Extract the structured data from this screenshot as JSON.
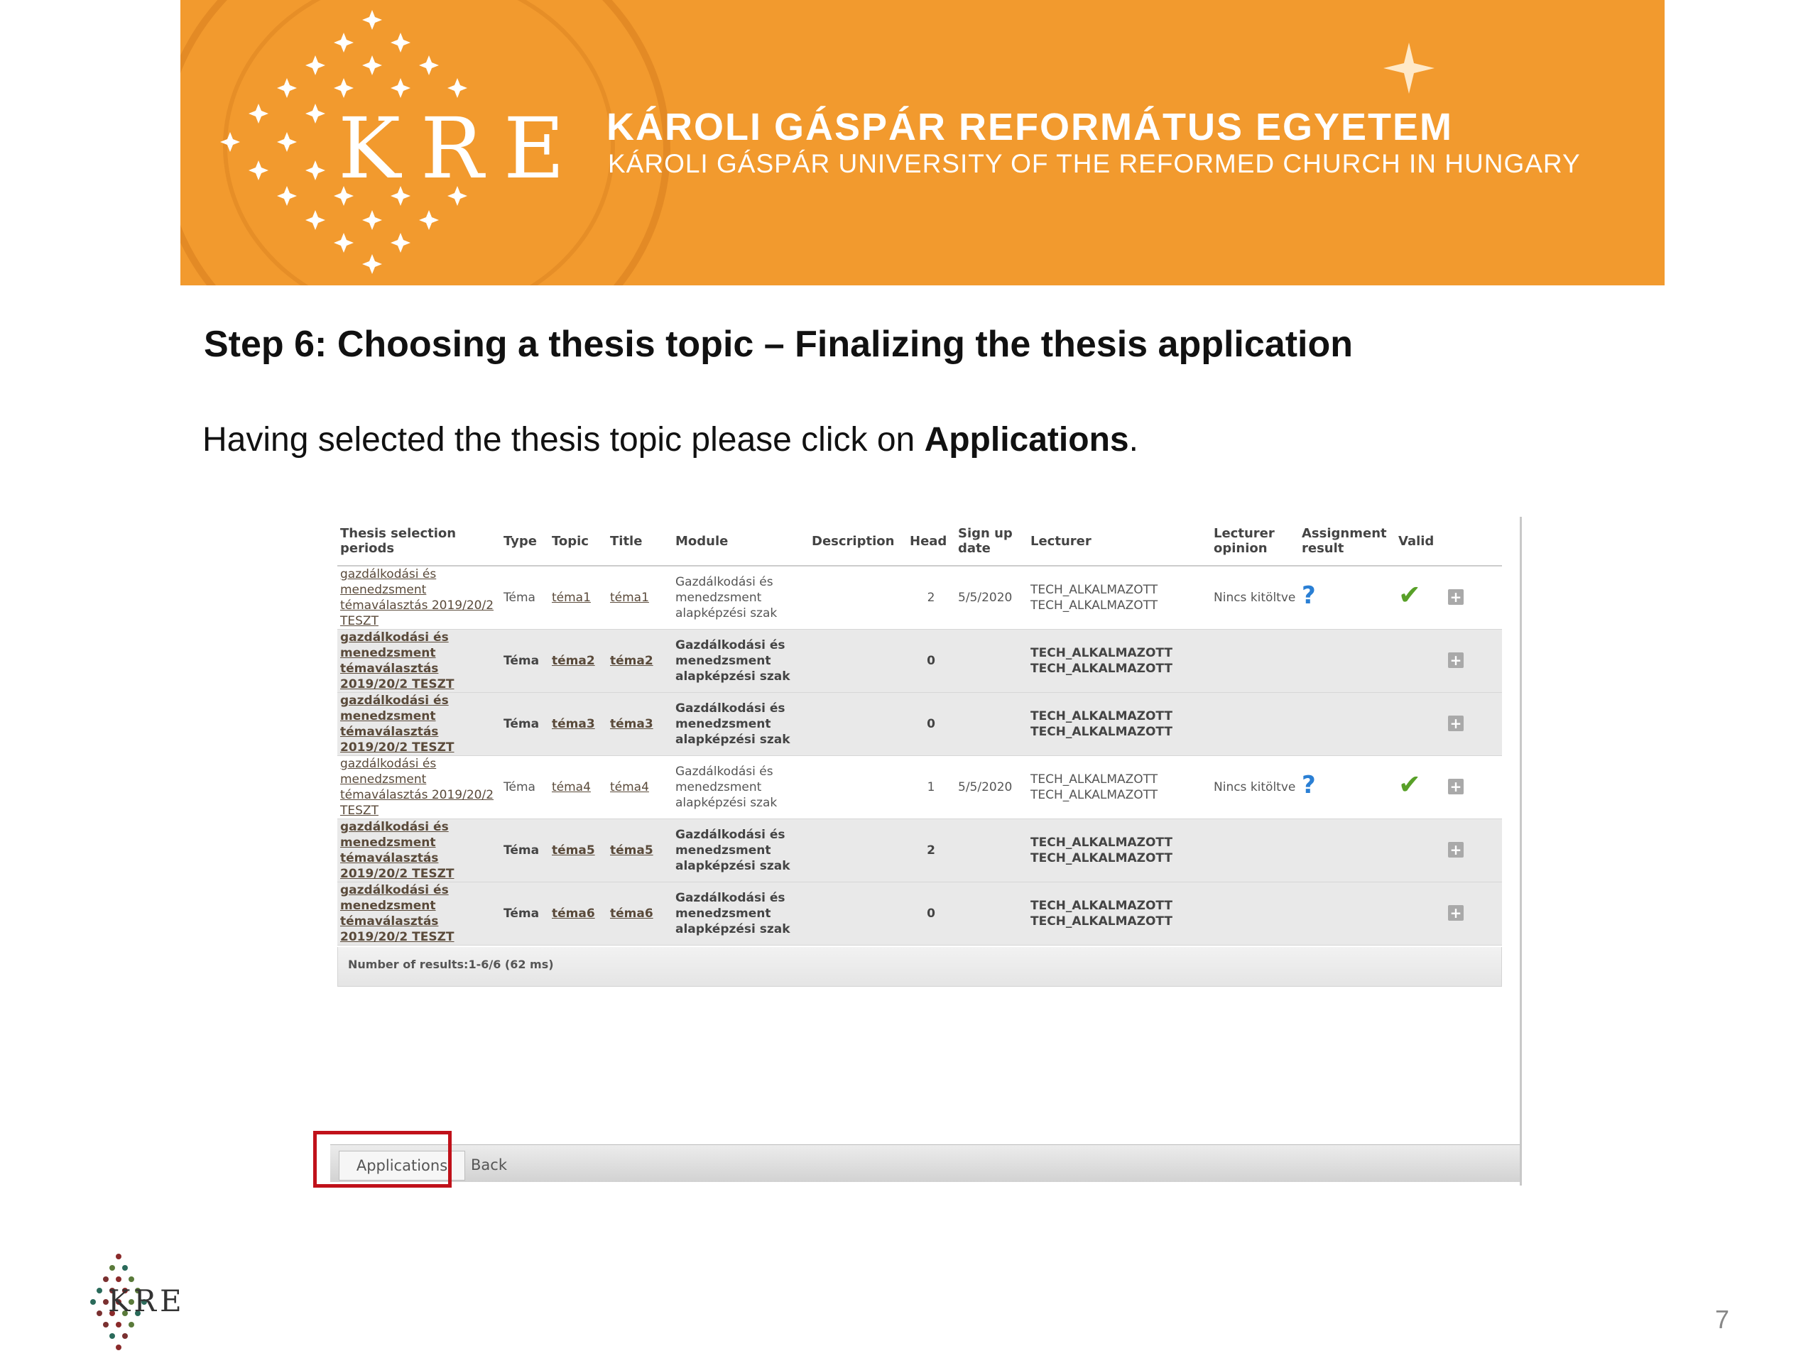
{
  "banner": {
    "logo": "KRE",
    "university_hu": "KÁROLI GÁSPÁR REFORMÁTUS EGYETEM",
    "university_en": "KÁROLI GÁSPÁR UNIVERSITY OF THE REFORMED CHURCH IN HUNGARY",
    "background_color": "#f29a2e"
  },
  "slide": {
    "heading": "Step 6: Choosing a thesis topic – Finalizing the thesis application",
    "intro_before": "Having selected the thesis topic please click on ",
    "intro_bold": "Applications",
    "intro_after": ".",
    "page_number": "7",
    "footer_logo": "KRE"
  },
  "table": {
    "headers": [
      "Thesis selection periods",
      "Type",
      "Topic",
      "Title",
      "Module",
      "Description",
      "Head",
      "Sign up date",
      "Lecturer",
      "Lecturer opinion",
      "Assignment result",
      "Valid",
      ""
    ],
    "rows": [
      {
        "period": "gazdálkodási és menedzsment témaválasztás 2019/20/2 TESZT",
        "type": "Téma",
        "topic": "téma1",
        "title": "téma1",
        "module": "Gazdálkodási és menedzsment alapképzési szak",
        "head": "2",
        "signup": "5/5/2020",
        "lecturer1": "TECH_ALKALMAZOTT",
        "lecturer2": "TECH_ALKALMAZOTT",
        "opinion": "Nincs kitöltve",
        "assignment": "?",
        "valid": "✔",
        "style": "light"
      },
      {
        "period": "gazdálkodási és menedzsment témaválasztás 2019/20/2 TESZT",
        "type": "Téma",
        "topic": "téma2",
        "title": "téma2",
        "module": "Gazdálkodási és menedzsment alapképzési szak",
        "head": "0",
        "signup": "",
        "lecturer1": "TECH_ALKALMAZOTT",
        "lecturer2": "TECH_ALKALMAZOTT",
        "opinion": "",
        "assignment": "",
        "valid": "",
        "style": "grey"
      },
      {
        "period": "gazdálkodási és menedzsment témaválasztás 2019/20/2 TESZT",
        "type": "Téma",
        "topic": "téma3",
        "title": "téma3",
        "module": "Gazdálkodási és menedzsment alapképzési szak",
        "head": "0",
        "signup": "",
        "lecturer1": "TECH_ALKALMAZOTT",
        "lecturer2": "TECH_ALKALMAZOTT",
        "opinion": "",
        "assignment": "",
        "valid": "",
        "style": "grey"
      },
      {
        "period": "gazdálkodási és menedzsment témaválasztás 2019/20/2 TESZT",
        "type": "Téma",
        "topic": "téma4",
        "title": "téma4",
        "module": "Gazdálkodási és menedzsment alapképzési szak",
        "head": "1",
        "signup": "5/5/2020",
        "lecturer1": "TECH_ALKALMAZOTT",
        "lecturer2": "TECH_ALKALMAZOTT",
        "opinion": "Nincs kitöltve",
        "assignment": "?",
        "valid": "✔",
        "style": "light"
      },
      {
        "period": "gazdálkodási és menedzsment témaválasztás 2019/20/2 TESZT",
        "type": "Téma",
        "topic": "téma5",
        "title": "téma5",
        "module": "Gazdálkodási és menedzsment alapképzési szak",
        "head": "2",
        "signup": "",
        "lecturer1": "TECH_ALKALMAZOTT",
        "lecturer2": "TECH_ALKALMAZOTT",
        "opinion": "",
        "assignment": "",
        "valid": "",
        "style": "grey"
      },
      {
        "period": "gazdálkodási és menedzsment témaválasztás 2019/20/2 TESZT",
        "type": "Téma",
        "topic": "téma6",
        "title": "téma6",
        "module": "Gazdálkodási és menedzsment alapképzési szak",
        "head": "0",
        "signup": "",
        "lecturer1": "TECH_ALKALMAZOTT",
        "lecturer2": "TECH_ALKALMAZOTT",
        "opinion": "",
        "assignment": "",
        "valid": "",
        "style": "grey"
      }
    ],
    "results_text": "Number of results:1-6/6 (62 ms)"
  },
  "buttons": {
    "applications": "Applications",
    "back": "Back",
    "highlight_color": "#c0111a"
  }
}
